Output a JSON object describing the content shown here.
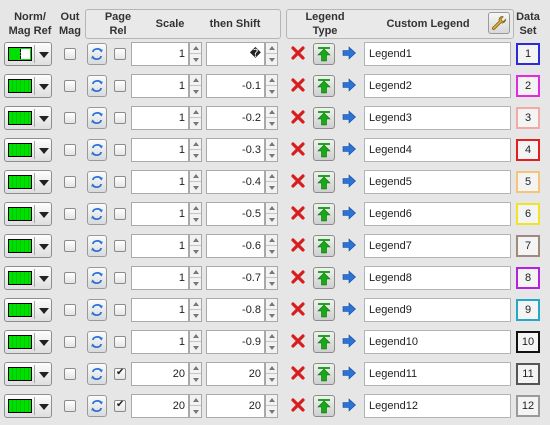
{
  "headers": {
    "norm_mag_ref": [
      "Norm/",
      "Mag Ref"
    ],
    "out_mag": [
      "Out",
      "Mag"
    ],
    "page_rel": [
      "Page",
      "Rel"
    ],
    "scale": "Scale",
    "then_shift": "then Shift",
    "legend_type": [
      "Legend",
      "Type"
    ],
    "custom_legend": "Custom Legend",
    "data_set": [
      "Data",
      "Set"
    ]
  },
  "rows": [
    {
      "scale": "1",
      "shift": "�",
      "page_rel": false,
      "legend": "Legend1",
      "dataset": "1",
      "color": "#2b2bd9"
    },
    {
      "scale": "1",
      "shift": "-0.1",
      "page_rel": false,
      "legend": "Legend2",
      "dataset": "2",
      "color": "#e22be0"
    },
    {
      "scale": "1",
      "shift": "-0.2",
      "page_rel": false,
      "legend": "Legend3",
      "dataset": "3",
      "color": "#f3aaa6"
    },
    {
      "scale": "1",
      "shift": "-0.3",
      "page_rel": false,
      "legend": "Legend4",
      "dataset": "4",
      "color": "#e11f1f"
    },
    {
      "scale": "1",
      "shift": "-0.4",
      "page_rel": false,
      "legend": "Legend5",
      "dataset": "5",
      "color": "#f6c476"
    },
    {
      "scale": "1",
      "shift": "-0.5",
      "page_rel": false,
      "legend": "Legend6",
      "dataset": "6",
      "color": "#f0e42a"
    },
    {
      "scale": "1",
      "shift": "-0.6",
      "page_rel": false,
      "legend": "Legend7",
      "dataset": "7",
      "color": "#a08a80"
    },
    {
      "scale": "1",
      "shift": "-0.7",
      "page_rel": false,
      "legend": "Legend8",
      "dataset": "8",
      "color": "#b222e0"
    },
    {
      "scale": "1",
      "shift": "-0.8",
      "page_rel": false,
      "legend": "Legend9",
      "dataset": "9",
      "color": "#27a7c8"
    },
    {
      "scale": "1",
      "shift": "-0.9",
      "page_rel": false,
      "legend": "Legend10",
      "dataset": "10",
      "color": "#111111"
    },
    {
      "scale": "20",
      "shift": "20",
      "page_rel": true,
      "legend": "Legend11",
      "dataset": "11",
      "color": "#555555"
    },
    {
      "scale": "20",
      "shift": "20",
      "page_rel": true,
      "legend": "Legend12",
      "dataset": "12",
      "color": "#9a9a9a"
    }
  ],
  "colors": {
    "swatch": "#00e000",
    "delete_icon": "#d61e1e",
    "type_icon": "#18a818",
    "go_icon": "#2a73d8"
  },
  "icons": {
    "wrench": "wrench-icon",
    "delete": "red-x-icon",
    "legend_type": "green-up-arrow-icon",
    "go": "blue-right-arrow-icon",
    "swap": "swap-arrows-icon"
  }
}
